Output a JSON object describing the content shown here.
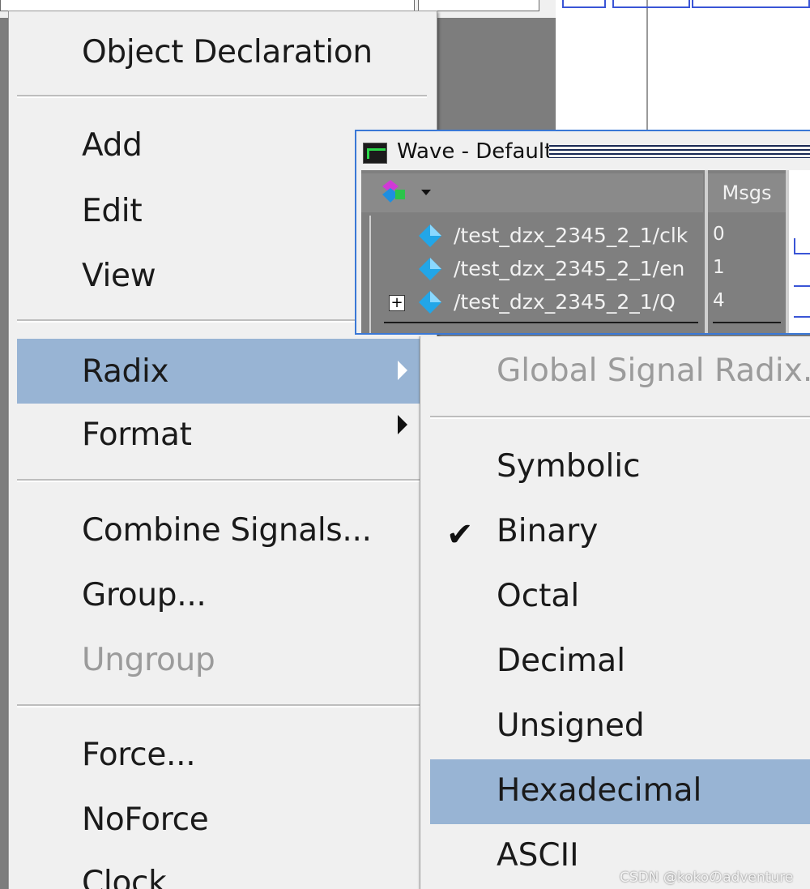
{
  "wave_window": {
    "title": "Wave - Default",
    "msgs_header": "Msgs",
    "signals": [
      {
        "name": "/test_dzx_2345_2_1/clk",
        "value": "0",
        "expandable": false
      },
      {
        "name": "/test_dzx_2345_2_1/en",
        "value": "1",
        "expandable": false
      },
      {
        "name": "/test_dzx_2345_2_1/Q",
        "value": "4",
        "expandable": true
      }
    ],
    "expand_symbol": "+"
  },
  "context_menu": {
    "items": [
      {
        "label": "Object Declaration"
      },
      {
        "label": "Add"
      },
      {
        "label": "Edit"
      },
      {
        "label": "View"
      },
      {
        "label": "Radix",
        "highlighted": true,
        "has_submenu": true
      },
      {
        "label": "Format",
        "has_submenu": true
      },
      {
        "label": "Combine Signals..."
      },
      {
        "label": "Group..."
      },
      {
        "label": "Ungroup",
        "disabled": true
      },
      {
        "label": "Force..."
      },
      {
        "label": "NoForce"
      },
      {
        "label": "Clock"
      }
    ]
  },
  "radix_submenu": {
    "items": [
      {
        "label": "Global Signal Radix...",
        "disabled": true
      },
      {
        "label": "Symbolic"
      },
      {
        "label": "Binary",
        "checked": true
      },
      {
        "label": "Octal"
      },
      {
        "label": "Decimal"
      },
      {
        "label": "Unsigned"
      },
      {
        "label": "Hexadecimal",
        "highlighted": true
      },
      {
        "label": "ASCII"
      }
    ],
    "check_glyph": "✔"
  },
  "watermark": "CSDN @kokoのadventure",
  "colors": {
    "highlight": "#98b4d4",
    "menu_bg": "#f0f0f0",
    "disabled_text": "#9b9b9b",
    "wave_border": "#3a78d6",
    "trace": "#3a55d6"
  }
}
